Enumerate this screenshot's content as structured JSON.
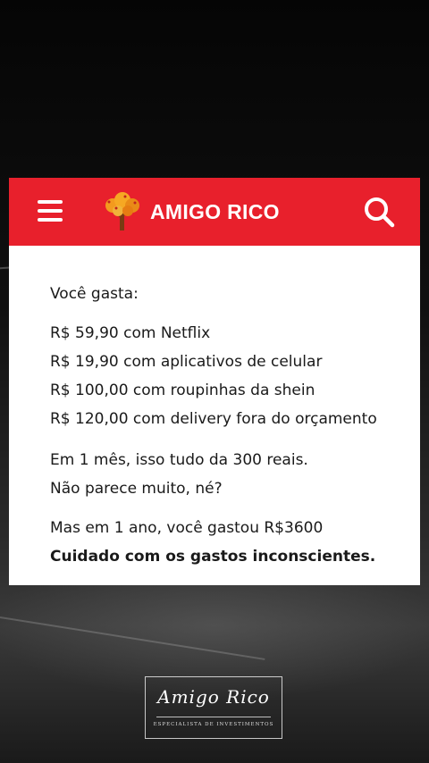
{
  "header": {
    "brand_name": "AMIGO RICO",
    "brand_color": "#e8202c",
    "menu_icon": "hamburger-menu-icon",
    "logo_icon": "tree-icon",
    "search_icon": "search-icon"
  },
  "post": {
    "intro": "Você gasta:",
    "expenses": [
      "R$ 59,90 com Netflix",
      "R$ 19,90 com aplicativos de celular",
      "R$ 100,00 com roupinhas da shein",
      "R$ 120,00 com delivery fora do orçamento"
    ],
    "monthly_total": "Em 1 mês, isso tudo da 300 reais.",
    "question": "Não parece muito, né?",
    "yearly_total": "Mas em 1 ano, você gastou R$3600",
    "warning": "Cuidado com os gastos inconscientes."
  },
  "signature": {
    "name": "Amigo Rico",
    "subtitle": "ESPECIALISTA DE INVESTIMENTOS"
  }
}
